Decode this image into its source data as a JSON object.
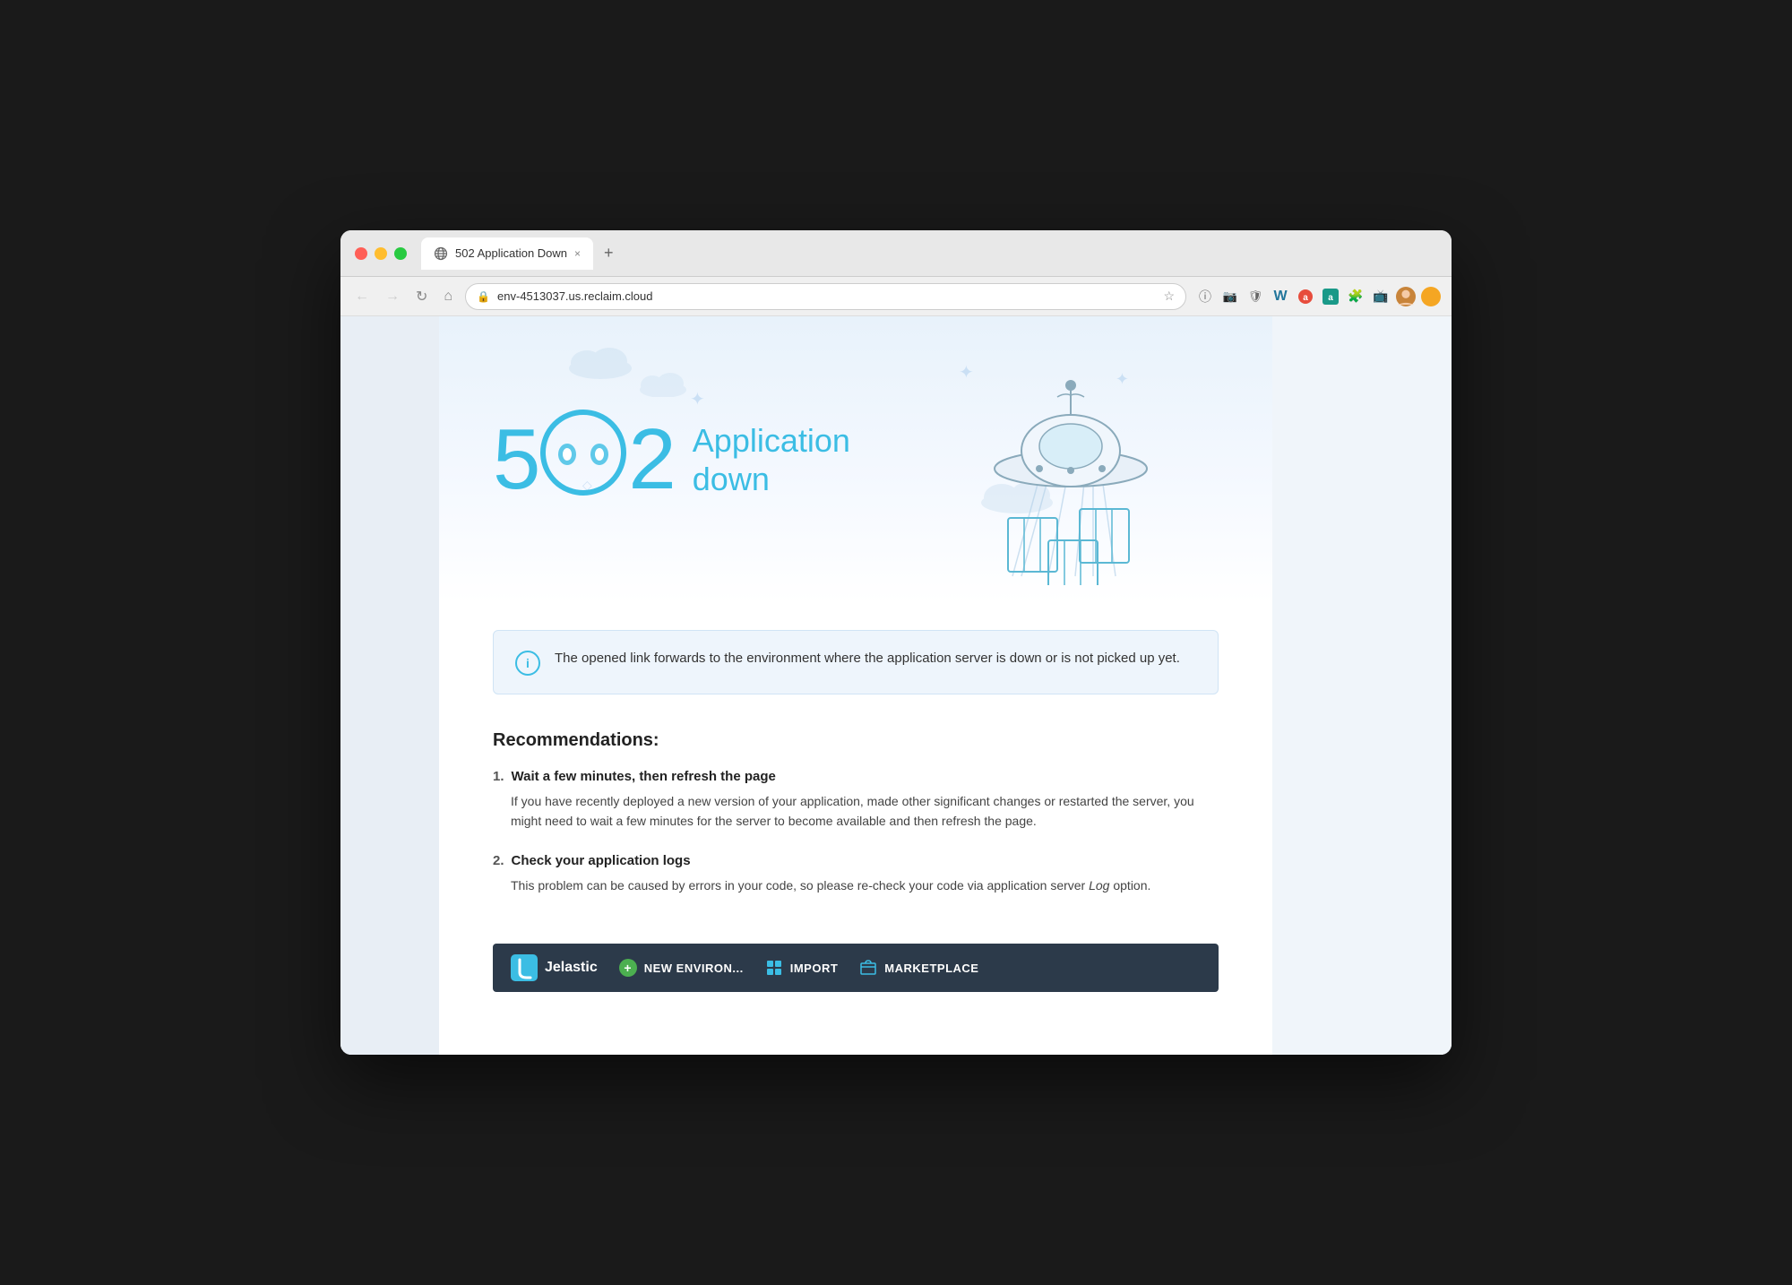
{
  "window": {
    "title": "502 Application Down",
    "url": "env-4513037.us.reclaim.cloud"
  },
  "tab": {
    "label": "502 Application Down",
    "close": "×",
    "add": "+"
  },
  "nav": {
    "back": "←",
    "forward": "→",
    "reload": "↻",
    "home": "⌂",
    "bookmark": "☆"
  },
  "hero": {
    "error_code": "502",
    "title_line1": "Application",
    "title_line2": "down"
  },
  "info_box": {
    "text": "The opened link forwards to the environment where the application server is down or is not picked up yet."
  },
  "recommendations": {
    "title": "Recommendations:",
    "items": [
      {
        "heading": "Wait a few minutes, then refresh the page",
        "body": "If you have recently deployed a new version of your application, made other significant changes or restarted the server, you might need to wait a few minutes for the server to become available and then refresh the page."
      },
      {
        "heading": "Check your application logs",
        "body_before": "This problem can be caused by errors in your code, so please re-check your code via application server ",
        "body_italic": "Log",
        "body_after": " option."
      }
    ]
  },
  "jelastic_bar": {
    "brand": "Jelastic",
    "buttons": [
      {
        "label": "NEW ENVIRON...",
        "icon_type": "plus"
      },
      {
        "label": "IMPORT",
        "icon_type": "grid"
      },
      {
        "label": "MARKETPLACE",
        "icon_type": "cart"
      }
    ]
  }
}
